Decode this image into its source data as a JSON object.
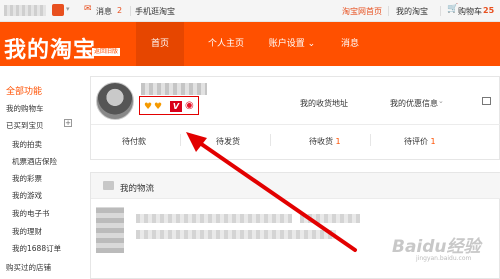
{
  "topbar": {
    "messages_label": "消息",
    "messages_count": "2",
    "mobile_label": "手机逛淘宝",
    "home_link": "淘宝网首页",
    "my_taobao": "我的淘宝",
    "cart_label": "购物车",
    "cart_count": "25"
  },
  "header": {
    "brand": "我的淘宝",
    "brand_tag": "返回旧版",
    "nav": [
      "首页",
      "个人主页",
      "账户设置",
      "消息"
    ]
  },
  "sidebar": {
    "title": "全部功能",
    "toggle": "+",
    "items": [
      "我的购物车",
      "已买到宝贝",
      "我的拍卖",
      "机票酒店保险",
      "我的彩票",
      "我的游戏",
      "我的电子书",
      "我的理财",
      "我的1688订单",
      "购买过的店铺"
    ]
  },
  "profile": {
    "address_link": "我的收货地址",
    "coupon_link": "我的优惠信息",
    "tmall_badge": "V"
  },
  "orders": [
    {
      "label": "待付款",
      "count": ""
    },
    {
      "label": "待发货",
      "count": ""
    },
    {
      "label": "待收货",
      "count": "1"
    },
    {
      "label": "待评价",
      "count": "1"
    }
  ],
  "logistics": {
    "title": "我的物流"
  },
  "watermark": {
    "text": "Baidu经验",
    "sub": "jingyan.baidu.com"
  },
  "colors": {
    "brand_orange": "#ff5000",
    "annotation_red": "#e20000"
  }
}
